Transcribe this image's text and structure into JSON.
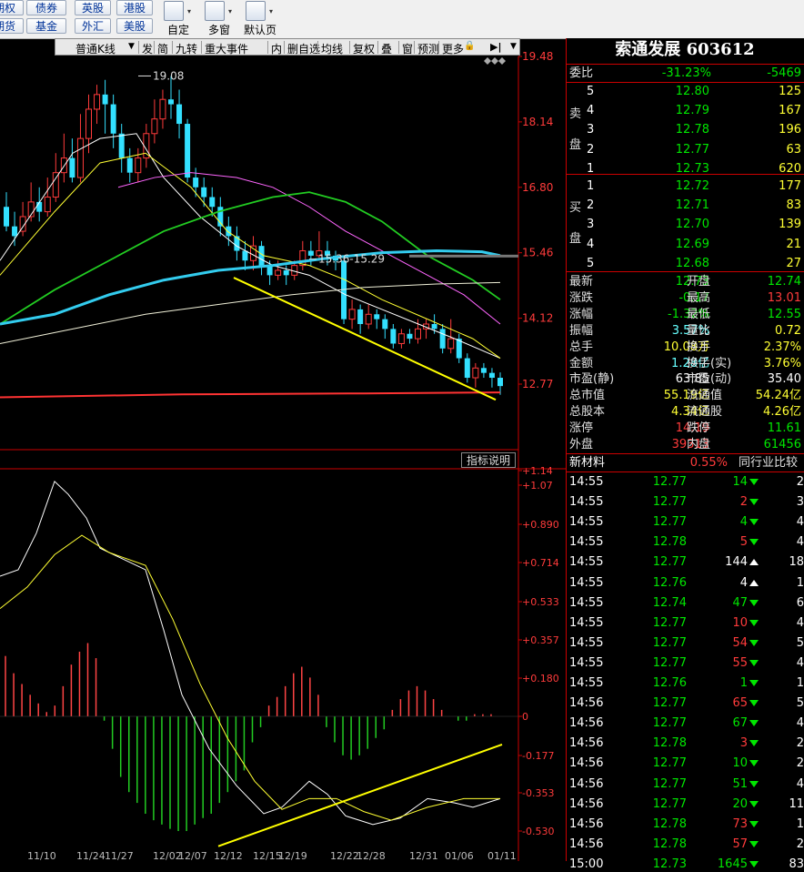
{
  "toolbar": {
    "row1": [
      "期权",
      "债券",
      "英股",
      "港股"
    ],
    "row2": [
      "期货",
      "基金",
      "外汇",
      "美股"
    ],
    "tools": [
      {
        "label": "自定",
        "icon": "custom-layout-icon"
      },
      {
        "label": "多窗",
        "icon": "multi-window-icon"
      },
      {
        "label": "默认页",
        "icon": "default-page-icon"
      }
    ]
  },
  "chart_toolbar": {
    "period": "普通K线",
    "items": [
      "发",
      "简",
      "九转",
      "重大事件",
      "内",
      "删自选",
      "均线",
      "复权",
      "叠",
      "窗",
      "预测",
      "更多"
    ]
  },
  "stock": {
    "name": "索通发展",
    "code": "603612"
  },
  "kline": {
    "price_axis": [
      "19.48",
      "18.14",
      "16.80",
      "15.46",
      "14.12",
      "12.77"
    ],
    "high_label": "19.08",
    "range_label": "15.36-15.29"
  },
  "indicator": {
    "button": "指标说明",
    "axis": [
      "+1.14",
      "+1.07",
      "+0.890",
      "+0.714",
      "+0.533",
      "+0.357",
      "+0.180",
      "0",
      "-0.177",
      "-0.353",
      "-0.530"
    ],
    "date_labels": [
      "11/10",
      "11/24",
      "11/27",
      "12/02",
      "12/07",
      "12/12",
      "12/15",
      "12/19",
      "12/22",
      "12/28",
      "12/31",
      "01/06",
      "01/11"
    ]
  },
  "weibi": {
    "label": "委比",
    "pct": "-31.23%",
    "value": "-5469"
  },
  "sell_label": [
    "卖",
    "盘"
  ],
  "buy_label": [
    "买",
    "盘"
  ],
  "sell": [
    {
      "level": "5",
      "price": "12.80",
      "vol": "125"
    },
    {
      "level": "4",
      "price": "12.79",
      "vol": "167"
    },
    {
      "level": "3",
      "price": "12.78",
      "vol": "196"
    },
    {
      "level": "2",
      "price": "12.77",
      "vol": "63"
    },
    {
      "level": "1",
      "price": "12.73",
      "vol": "620"
    }
  ],
  "buy": [
    {
      "level": "1",
      "price": "12.72",
      "vol": "177"
    },
    {
      "level": "2",
      "price": "12.71",
      "vol": "83"
    },
    {
      "level": "3",
      "price": "12.70",
      "vol": "139"
    },
    {
      "level": "4",
      "price": "12.69",
      "vol": "21"
    },
    {
      "level": "5",
      "price": "12.68",
      "vol": "27"
    }
  ],
  "quote": [
    {
      "l1": "最新",
      "v1": "12.73",
      "c1": "green",
      "l2": "开盘",
      "v2": "12.74",
      "c2": "green"
    },
    {
      "l1": "涨跌",
      "v1": "-0.17",
      "c1": "green",
      "l2": "最高",
      "v2": "13.01",
      "c2": "red"
    },
    {
      "l1": "涨幅",
      "v1": "-1.32%",
      "c1": "green",
      "l2": "最低",
      "v2": "12.55",
      "c2": "green"
    },
    {
      "l1": "振幅",
      "v1": "3.57%",
      "c1": "cyan",
      "l2": "量比",
      "v2": "0.72",
      "c2": "yellow"
    },
    {
      "l1": "总手",
      "v1": "10.08万",
      "c1": "yellow",
      "l2": "换手",
      "v2": "2.37%",
      "c2": "yellow"
    },
    {
      "l1": "金额",
      "v1": "1.28亿",
      "c1": "cyan",
      "l2": "换手(实)",
      "v2": "3.76%",
      "c2": "yellow"
    },
    {
      "l1": "市盈(静)",
      "v1": "63.85",
      "c1": "white",
      "l2": "市盈(动)",
      "v2": "35.40",
      "c2": "white"
    },
    {
      "l1": "总市值",
      "v1": "55.19亿",
      "c1": "yellow",
      "l2": "流通值",
      "v2": "54.24亿",
      "c2": "yellow"
    },
    {
      "l1": "总股本",
      "v1": "4.34亿",
      "c1": "yellow",
      "l2": "流通股",
      "v2": "4.26亿",
      "c2": "yellow"
    },
    {
      "l1": "涨停",
      "v1": "14.19",
      "c1": "red",
      "l2": "跌停",
      "v2": "11.61",
      "c2": "green"
    },
    {
      "l1": "外盘",
      "v1": "39313",
      "c1": "red",
      "l2": "内盘",
      "v2": "61456",
      "c2": "green"
    }
  ],
  "industry": {
    "name": "新材料",
    "pct": "0.55%",
    "compare": "同行业比较"
  },
  "ticks": [
    {
      "time": "14:55",
      "price": "12.77",
      "pc": "green",
      "vol": "14",
      "vc": "green",
      "dir": "down",
      "n": "2"
    },
    {
      "time": "14:55",
      "price": "12.77",
      "pc": "green",
      "vol": "2",
      "vc": "red",
      "dir": "down",
      "n": "3"
    },
    {
      "time": "14:55",
      "price": "12.77",
      "pc": "green",
      "vol": "4",
      "vc": "green",
      "dir": "down",
      "n": "4"
    },
    {
      "time": "14:55",
      "price": "12.78",
      "pc": "green",
      "vol": "5",
      "vc": "red",
      "dir": "down",
      "n": "4"
    },
    {
      "time": "14:55",
      "price": "12.77",
      "pc": "green",
      "vol": "144",
      "vc": "white",
      "dir": "upw",
      "n": "18"
    },
    {
      "time": "14:55",
      "price": "12.76",
      "pc": "green",
      "vol": "4",
      "vc": "white",
      "dir": "upw",
      "n": "1"
    },
    {
      "time": "14:55",
      "price": "12.74",
      "pc": "green",
      "vol": "47",
      "vc": "green",
      "dir": "down",
      "n": "6"
    },
    {
      "time": "14:55",
      "price": "12.77",
      "pc": "green",
      "vol": "10",
      "vc": "red",
      "dir": "down",
      "n": "4"
    },
    {
      "time": "14:55",
      "price": "12.77",
      "pc": "green",
      "vol": "54",
      "vc": "red",
      "dir": "down",
      "n": "5"
    },
    {
      "time": "14:55",
      "price": "12.77",
      "pc": "green",
      "vol": "55",
      "vc": "red",
      "dir": "down",
      "n": "4"
    },
    {
      "time": "14:55",
      "price": "12.76",
      "pc": "green",
      "vol": "1",
      "vc": "green",
      "dir": "down",
      "n": "1"
    },
    {
      "time": "14:56",
      "price": "12.77",
      "pc": "green",
      "vol": "65",
      "vc": "red",
      "dir": "down",
      "n": "5"
    },
    {
      "time": "14:56",
      "price": "12.77",
      "pc": "green",
      "vol": "67",
      "vc": "green",
      "dir": "down",
      "n": "4"
    },
    {
      "time": "14:56",
      "price": "12.78",
      "pc": "green",
      "vol": "3",
      "vc": "red",
      "dir": "down",
      "n": "2"
    },
    {
      "time": "14:56",
      "price": "12.77",
      "pc": "green",
      "vol": "10",
      "vc": "green",
      "dir": "down",
      "n": "2"
    },
    {
      "time": "14:56",
      "price": "12.77",
      "pc": "green",
      "vol": "51",
      "vc": "green",
      "dir": "down",
      "n": "4"
    },
    {
      "time": "14:56",
      "price": "12.77",
      "pc": "green",
      "vol": "20",
      "vc": "green",
      "dir": "down",
      "n": "11"
    },
    {
      "time": "14:56",
      "price": "12.78",
      "pc": "green",
      "vol": "73",
      "vc": "red",
      "dir": "down",
      "n": "1"
    },
    {
      "time": "14:56",
      "price": "12.78",
      "pc": "green",
      "vol": "57",
      "vc": "red",
      "dir": "down",
      "n": "2"
    },
    {
      "time": "15:00",
      "price": "12.73",
      "pc": "green",
      "vol": "1645",
      "vc": "green",
      "dir": "down",
      "n": "83"
    }
  ]
}
